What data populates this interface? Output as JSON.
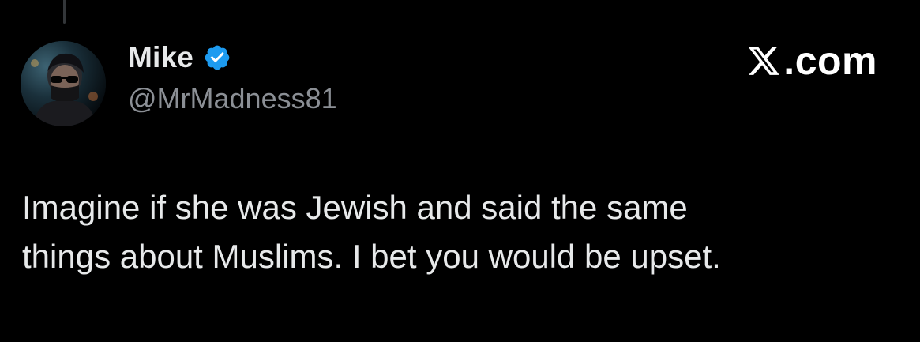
{
  "author": {
    "display_name": "Mike",
    "handle": "@MrMadness81",
    "verified": true,
    "avatar_icon": "avatar-masked-man-sunglasses"
  },
  "brand": {
    "icon": "x-logo-icon",
    "label": ".com"
  },
  "tweet": {
    "lines": [
      "Imagine if she was Jewish and said the same",
      "things about Muslims. I bet you would be upset."
    ]
  },
  "colors": {
    "background": "#000000",
    "text_primary": "#e7e9ea",
    "text_secondary": "#8b8f95",
    "verified_blue": "#1d9bf0"
  }
}
